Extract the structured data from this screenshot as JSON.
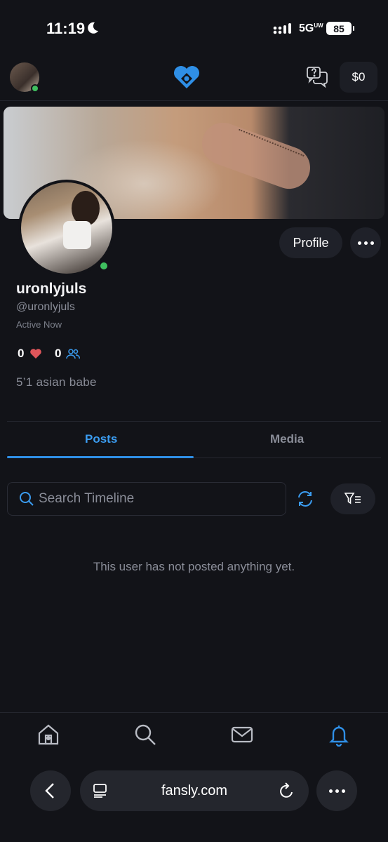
{
  "status_bar": {
    "time": "11:19",
    "network": "5G",
    "network_suffix": "UW",
    "battery": "85"
  },
  "header": {
    "wallet_label": "$0",
    "accent_color": "#2f8fe6"
  },
  "profile": {
    "display_name": "uronlyjuls",
    "handle": "@uronlyjuls",
    "status": "Active Now",
    "likes_count": "0",
    "followers_count": "0",
    "bio": "5’1 asian babe",
    "profile_button_label": "Profile"
  },
  "tabs": [
    {
      "label": "Posts",
      "active": true
    },
    {
      "label": "Media",
      "active": false
    }
  ],
  "search": {
    "placeholder": "Search Timeline"
  },
  "timeline": {
    "empty_message": "This user has not posted anything yet."
  },
  "bottom_nav": {
    "items": [
      "home-icon",
      "search-icon",
      "mail-icon",
      "bell-icon"
    ],
    "active": "bell-icon"
  },
  "browser": {
    "url": "fansly.com"
  }
}
